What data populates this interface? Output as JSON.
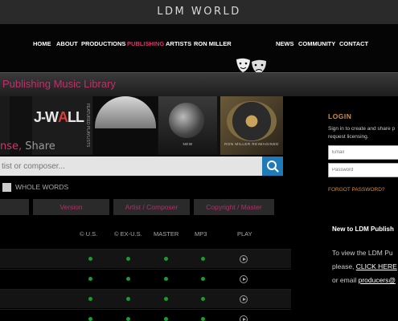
{
  "site": {
    "brand": "LDM WORLD"
  },
  "nav": {
    "items": [
      {
        "label": "HOME",
        "active": false
      },
      {
        "label": "ABOUT",
        "active": false
      },
      {
        "label": "PRODUCTIONS",
        "active": false
      },
      {
        "label": "PUBLISHING",
        "active": true
      },
      {
        "label": "ARTISTS",
        "active": false
      },
      {
        "label": "RON MILLER",
        "active": false
      },
      {
        "label": "NEWS",
        "active": false
      },
      {
        "label": "COMMUNITY",
        "active": false
      },
      {
        "label": "CONTACT",
        "active": false
      }
    ]
  },
  "page": {
    "title": "Publishing Music Library"
  },
  "banner": {
    "jwall_left": "J-W",
    "jwall_mid": "A",
    "jwall_right": "LL",
    "vertical_caption": "FEATURED PLAYLISTS",
    "tile4_caption": "NEW",
    "tile5_caption": "RON MILLER REIMAGINED",
    "slogan_part1": "nse,",
    "slogan_part2": " Share"
  },
  "search": {
    "placeholder": "tist or composer...",
    "value": ""
  },
  "whole_words_label": "WHOLE WORDS",
  "filters": [
    "",
    "Version",
    "Artist / Composer",
    "Copyright / Master"
  ],
  "columns": [
    "© U.S.",
    "© EX-U.S.",
    "MASTER",
    "MP3",
    "PLAY"
  ],
  "rows": [
    {
      "us": true,
      "ex_us": true,
      "master": true,
      "mp3": true
    },
    {
      "us": true,
      "ex_us": true,
      "master": true,
      "mp3": true
    },
    {
      "us": true,
      "ex_us": true,
      "master": true,
      "mp3": true
    },
    {
      "us": true,
      "ex_us": true,
      "master": true,
      "mp3": true
    }
  ],
  "login": {
    "title": "LOGIN",
    "desc_line1": "Sign in to create and share p",
    "desc_line2": "request licensing.",
    "email_placeholder": "Email",
    "password_placeholder": "Password",
    "forgot": "FORGOT PASSWORD?"
  },
  "new_section": {
    "title": "New to LDM Publish",
    "line1": "To view the LDM Pu",
    "line2_prefix": "please, ",
    "line2_link": "CLICK HERE",
    "line3_prefix": "or email ",
    "line3_link": "producers@"
  },
  "colors": {
    "accent": "#d6336c",
    "login": "#e08a2e",
    "search_button": "#1e7bb8",
    "status_dot": "#1a9b2e"
  },
  "icons": {
    "search": "search-icon",
    "play": "play-icon",
    "masks": "theater-masks-icon"
  }
}
